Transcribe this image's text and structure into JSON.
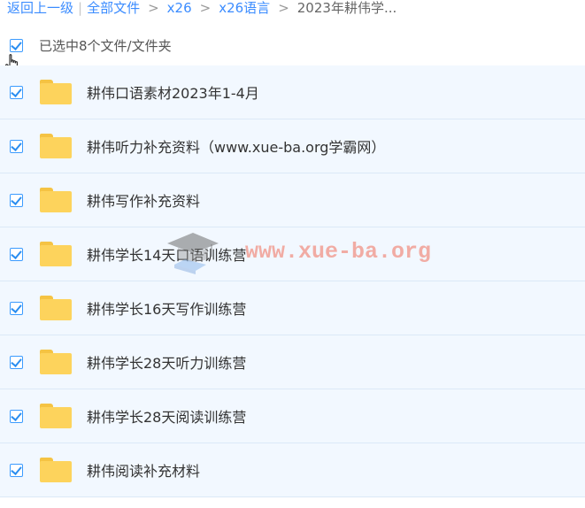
{
  "breadcrumb": {
    "back": "返回上一级",
    "divider": "|",
    "items": [
      "全部文件",
      "x26",
      "x26语言"
    ],
    "current": "2023年耕伟学...",
    "separator": ">"
  },
  "selection": {
    "summary": "已选中8个文件/文件夹",
    "all_checked": true
  },
  "files": [
    {
      "name": "耕伟口语素材2023年1-4月",
      "type": "folder",
      "checked": true
    },
    {
      "name": "耕伟听力补充资料（www.xue-ba.org学霸网）",
      "type": "folder",
      "checked": true
    },
    {
      "name": "耕伟写作补充资料",
      "type": "folder",
      "checked": true
    },
    {
      "name": "耕伟学长14天口语训练营",
      "type": "folder",
      "checked": true
    },
    {
      "name": "耕伟学长16天写作训练营",
      "type": "folder",
      "checked": true
    },
    {
      "name": "耕伟学长28天听力训练营",
      "type": "folder",
      "checked": true
    },
    {
      "name": "耕伟学长28天阅读训练营",
      "type": "folder",
      "checked": true
    },
    {
      "name": "耕伟阅读补充材料",
      "type": "folder",
      "checked": true
    }
  ],
  "watermark": {
    "text": "www.xue-ba.org",
    "logo": "graduation-cap-logo"
  },
  "icons": {
    "checkbox": "checkbox-checked-icon",
    "folder": "folder-icon",
    "cursor": "hand-pointer-icon"
  },
  "colors": {
    "link": "#3b8cff",
    "check": "#2b8ef0",
    "row_bg": "#f2f8ff",
    "folder": "#fdd35c",
    "watermark": "#f06e5a"
  }
}
